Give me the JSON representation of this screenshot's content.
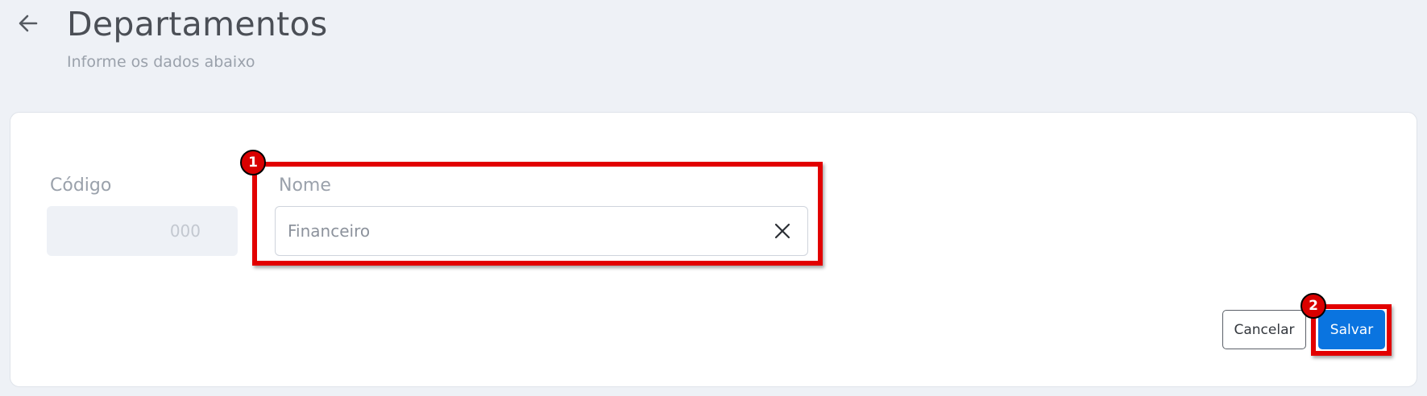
{
  "header": {
    "back_icon": "arrow-left-icon",
    "title": "Departamentos",
    "subtitle": "Informe os dados abaixo"
  },
  "form": {
    "codigo": {
      "label": "Código",
      "placeholder": "000",
      "value": ""
    },
    "nome": {
      "label": "Nome",
      "value": "Financeiro",
      "clear_icon": "close-icon"
    }
  },
  "actions": {
    "cancel_label": "Cancelar",
    "save_label": "Salvar"
  },
  "annotations": {
    "step_1": "1",
    "step_2": "2",
    "highlight_color": "#e20000"
  },
  "colors": {
    "background": "#eef1f6",
    "primary": "#0a74e0"
  }
}
